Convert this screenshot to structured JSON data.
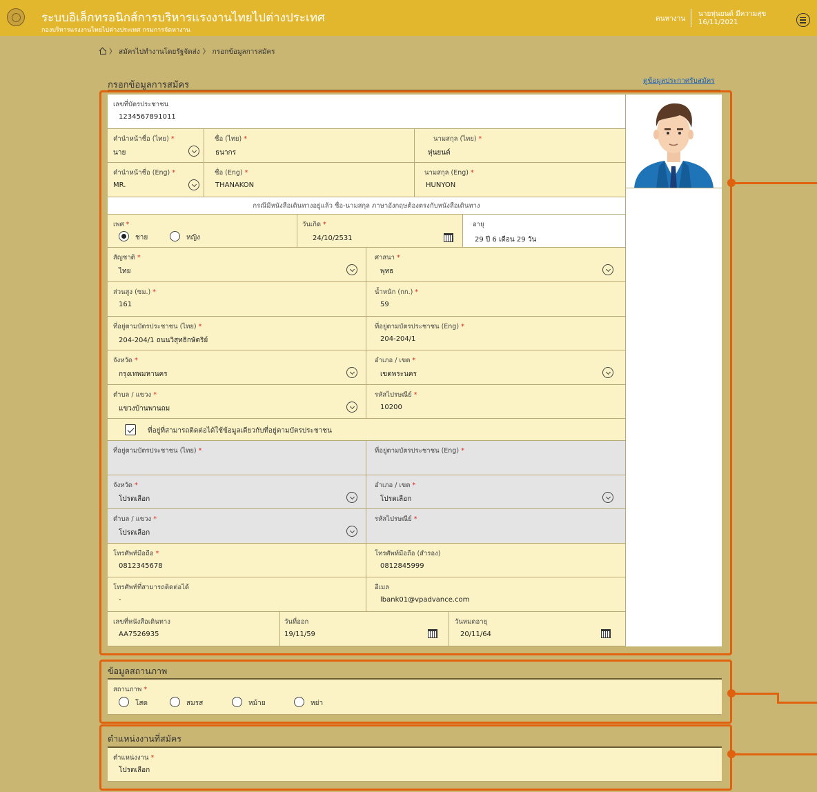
{
  "header": {
    "title": "ระบบอิเล็กทรอนิกส์การบริหารแรงงานไทยไปต่างประเทศ",
    "subtitle": "กองบริหารแรงงานไทยไปต่างประเทศ กรมการจัดหางาน",
    "role": "คนหางาน",
    "user_name": "นายหุ่นยนต์ มีความสุข",
    "date": "16/11/2021"
  },
  "breadcrumb": {
    "item1": "สมัครไปทำงานโดยรัฐจัดส่ง",
    "item2": "กรอกข้อมูลการสมัคร",
    "sep": "〉"
  },
  "page": {
    "title": "กรอกข้อมูลการสมัคร",
    "view_announcement_link": "ดูข้อมูลประกาศรับสมัคร"
  },
  "personal": {
    "id_card": {
      "label": "เลขที่บัตรประชาชน",
      "value": "1234567891011"
    },
    "prefix_th": {
      "label": "คำนำหน้าชื่อ (ไทย)",
      "value": "นาย"
    },
    "first_th": {
      "label": "ชื่อ (ไทย)",
      "value": "ธนากร"
    },
    "last_th": {
      "label": "นามสกุล (ไทย)",
      "value": "หุ่นยนต์"
    },
    "prefix_en": {
      "label": "คำนำหน้าชื่อ (Eng)",
      "value": "MR."
    },
    "first_en": {
      "label": "ชื่อ (Eng)",
      "value": "THANAKON"
    },
    "last_en": {
      "label": "นามสกุล (Eng)",
      "value": "HUNYON"
    },
    "passport_note": "กรณีมีหนังสือเดินทางอยู่แล้ว ชื่อ-นามสกุล ภาษาอังกฤษต้องตรงกับหนังสือเดินทาง",
    "gender": {
      "label": "เพศ",
      "options": [
        "ชาย",
        "หญิง"
      ],
      "selected": "ชาย"
    },
    "birth": {
      "label": "วันเกิด",
      "value": "24/10/2531"
    },
    "age": {
      "label": "อายุ",
      "value": "29 ปี 6 เดือน 29 วัน"
    },
    "nationality": {
      "label": "สัญชาติ",
      "value": "ไทย"
    },
    "religion": {
      "label": "ศาสนา",
      "value": "พุทธ"
    },
    "height": {
      "label": "ส่วนสูง (ซม.)",
      "value": "161"
    },
    "weight": {
      "label": "น้ำหนัก (กก.)",
      "value": "59"
    },
    "addr_th": {
      "label": "ที่อยู่ตามบัตรประชาชน (ไทย)",
      "value": "204-204/1 ถนนวิสุทธิกษัตริย์"
    },
    "addr_en": {
      "label": "ที่อยู่ตามบัตรประชาชน (Eng)",
      "value": "204-204/1"
    },
    "province": {
      "label": "จังหวัด",
      "value": "กรุงเทพมหานคร"
    },
    "district": {
      "label": "อำเภอ / เขต",
      "value": "เขตพระนคร"
    },
    "subdistrict": {
      "label": "ตำบล / แขวง",
      "value": "แขวงบ้านพานถม"
    },
    "postcode": {
      "label": "รหัสไปรษณีย์",
      "value": "10200"
    },
    "same_address_label": "ที่อยู่ที่สามารถติดต่อได้ใช้ข้อมูลเดียวกับที่อยู่ตามบัตรประชาชน",
    "c_addr_th": {
      "label": "ที่อยู่ตามบัตรประชาชน (ไทย)"
    },
    "c_addr_en": {
      "label": "ที่อยู่ตามบัตรประชาชน (Eng)"
    },
    "c_province": {
      "label": "จังหวัด",
      "value": "โปรดเลือก"
    },
    "c_district": {
      "label": "อำเภอ / เขต",
      "value": "โปรดเลือก"
    },
    "c_subdistrict": {
      "label": "ตำบล / แขวง",
      "value": "โปรดเลือก"
    },
    "c_postcode": {
      "label": "รหัสไปรษณีย์"
    },
    "mobile": {
      "label": "โทรศัพท์มือถือ",
      "value": "0812345678"
    },
    "mobile2": {
      "label": "โทรศัพท์มือถือ (สำรอง)",
      "value": "0812845999"
    },
    "contact_phone": {
      "label": "โทรศัพท์ที่สามารถติดต่อได้",
      "value": "-"
    },
    "email": {
      "label": "อีเมล",
      "value": "lbank01@vpadvance.com"
    },
    "passport_no": {
      "label": "เลขที่หนังสือเดินทาง",
      "value": "AA7526935"
    },
    "issue_date": {
      "label": "วันที่ออก",
      "value": "19/11/59"
    },
    "expiry_date": {
      "label": "วันหมดอายุ",
      "value": "20/11/64"
    }
  },
  "status_section": {
    "title": "ข้อมูลสถานภาพ",
    "label": "สถานภาพ",
    "options": [
      "โสด",
      "สมรส",
      "หม้าย",
      "หย่า"
    ]
  },
  "position_section": {
    "title": "ตำแหน่งงานที่สมัคร",
    "label": "ตำแหน่งงาน",
    "value": "โปรดเลือก"
  },
  "required_mark": "*",
  "colors": {
    "accent": "#e1620e",
    "topbar": "#e3b72d",
    "background": "#c9b673",
    "field": "#fbf3c5",
    "disabled": "#e4e4e4"
  }
}
